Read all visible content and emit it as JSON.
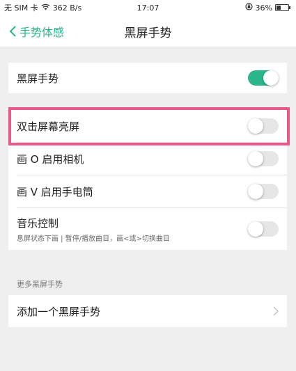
{
  "status_bar": {
    "carrier": "无 SIM 卡",
    "speed": "362 B/s",
    "time": "17:07",
    "battery": "36%",
    "battery_level": 0.36
  },
  "nav": {
    "back_label": "手势体感",
    "title": "黑屏手势"
  },
  "main_toggle": {
    "label": "黑屏手势",
    "on": true
  },
  "gestures": [
    {
      "label": "双击屏幕亮屏",
      "on": false
    },
    {
      "label": "画 O 启用相机",
      "on": false
    },
    {
      "label": "画 V 启用手电筒",
      "on": false
    }
  ],
  "music": {
    "label": "音乐控制",
    "subtitle": "息屏状态下画 | 暂停/播放曲目，画<或>切换曲目",
    "on": false
  },
  "more_section": {
    "header": "更多黑屏手势",
    "add_label": "添加一个黑屏手势"
  },
  "colors": {
    "accent": "#2bb58a",
    "highlight": "#e8588a"
  },
  "icons": {
    "back": "chevron-left-icon",
    "wifi": "wifi-icon",
    "battery": "battery-icon",
    "more": "chevron-right-icon"
  }
}
